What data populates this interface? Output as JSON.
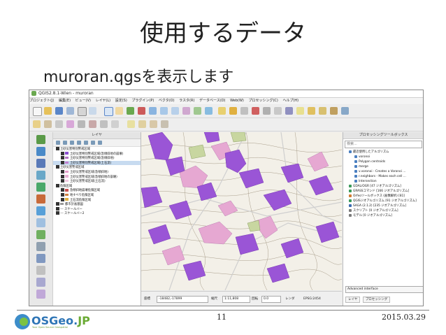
{
  "slide": {
    "title": "使用するデータ",
    "subtitle": "muroran.qgsを表示します",
    "page_number": "11",
    "date": "2015.03.29",
    "logo_text": "OSGeo.",
    "logo_jp": "JP",
    "logo_tagline": "Your Open Source Geospatial"
  },
  "app": {
    "window_title": "QGIS2.8.1-Wien - muroran",
    "menu": [
      "プロジェクト(J)",
      "編集(E)",
      "ビュー(V)",
      "レイヤ(L)",
      "設定(S)",
      "プラグイン(P)",
      "ベクタ(O)",
      "ラスタ(R)",
      "データベース(D)",
      "Web(W)",
      "プロセッシング(C)",
      "ヘルプ(H)"
    ]
  },
  "layers_panel": {
    "title": "レイヤ",
    "items": [
      {
        "label": "土砂災害特別警戒区域",
        "level": 0,
        "swatch": ""
      },
      {
        "label": "土砂災害特別警戒区域(急傾斜地の崩壊)",
        "level": 1,
        "swatch": "#8a4fd0"
      },
      {
        "label": "土砂災害特別警戒区域(急傾斜地)",
        "level": 1,
        "swatch": "#b070c0"
      },
      {
        "label": "土砂災害特別警戒区域(土石流)",
        "level": 1,
        "swatch": "#c080d0",
        "selected": true
      },
      {
        "label": "土砂災害警戒区域",
        "level": 0,
        "swatch": ""
      },
      {
        "label": "土砂災害警戒区域(急傾斜地)",
        "level": 1,
        "swatch": "#e39ec9"
      },
      {
        "label": "土砂災害警戒区域(急傾斜地の崩壊)",
        "level": 1,
        "swatch": "#e7b0d3"
      },
      {
        "label": "土砂災害警戒区域(土石流)",
        "level": 1,
        "swatch": "#f0c8e0"
      },
      {
        "label": "危険区域",
        "level": 0,
        "swatch": ""
      },
      {
        "label": "急傾斜地崩壊危険区域",
        "level": 1,
        "swatch": "#c85050"
      },
      {
        "label": "地すべり危険区域",
        "level": 1,
        "swatch": "#d08040"
      },
      {
        "label": "土石流危険区域",
        "level": 1,
        "swatch": "#e0b040"
      },
      {
        "label": "都市計画基図",
        "level": 0,
        "swatch": "#999999"
      },
      {
        "label": "--- スケールバー",
        "level": 0,
        "swatch": ""
      },
      {
        "label": "--- スケールバー2",
        "level": 0,
        "swatch": ""
      }
    ]
  },
  "processing_panel": {
    "title": "プロセッシングツールボックス",
    "search_placeholder": "検索...",
    "items": [
      {
        "label": "最近使用したアルゴリズム",
        "color": "#4a7fc0"
      },
      {
        "label": "voronoi",
        "color": "#4a7fc0"
      },
      {
        "label": "Polygon centroids",
        "color": "#4a7fc0"
      },
      {
        "label": "merge",
        "color": "#4a7fc0"
      },
      {
        "label": "v.voronoi - Creates a Voronoi ...",
        "color": "#4a7fc0"
      },
      {
        "label": "r.neighbors - Makes each cell ...",
        "color": "#4a7fc0"
      },
      {
        "label": "Intersection",
        "color": "#4a7fc0"
      },
      {
        "label": "GDAL/OGR [47 ジオアルゴリズム]",
        "color": "#3a9a5a"
      },
      {
        "label": "GRASSコマンド [166 ジオアルゴリズム]",
        "color": "#3a9a5a"
      },
      {
        "label": "Orfeoツールボックス (画像解析) [81]",
        "color": "#d07a30"
      },
      {
        "label": "QGISジオアルゴリズム [91 ジオアルゴリズム]",
        "color": "#3a9a5a"
      },
      {
        "label": "SAGA (2.1.2) [235 ジオアルゴリズム]",
        "color": "#3a6ab0"
      },
      {
        "label": "スクリプト [0 ジオアルゴリズム]",
        "color": "#7a7a7a"
      },
      {
        "label": "モデル [0 ジオアルゴリズム]",
        "color": "#7a7a7a"
      }
    ],
    "mode_select": "Advanced interface",
    "tabs": [
      "レイヤ",
      "プロセッシング"
    ]
  },
  "status": {
    "coord_label": "座標",
    "coord_value": "-18482,-17899",
    "scale_label": "縮尺",
    "scale_value": "1:11,808",
    "rotation_label": "回転",
    "rotation_value": "0.0",
    "render_label": "レンダ",
    "crs": "EPSG:2454"
  },
  "colors": {
    "purple_polygon": "#9a55d6",
    "pink_polygon": "#e6a8d2",
    "map_bg": "#f3f0e8",
    "contour": "#a89d8a"
  }
}
